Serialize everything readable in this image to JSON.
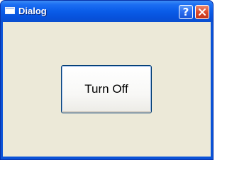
{
  "window": {
    "title": "Dialog",
    "help_label": "?",
    "close_label": "Close"
  },
  "main": {
    "turn_off_label": "Turn Off"
  },
  "colors": {
    "titlebar": "#0a5ce8",
    "client_background": "#ece9d8",
    "close_button": "#dc4a2c",
    "help_button": "#2a6cf0"
  }
}
